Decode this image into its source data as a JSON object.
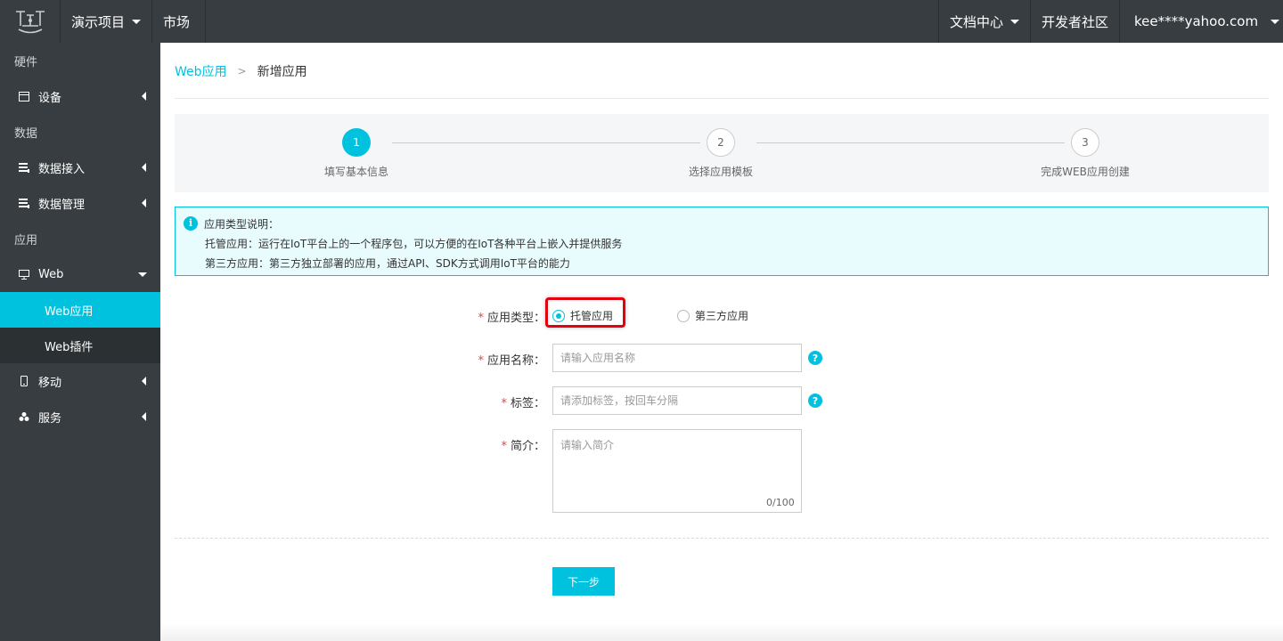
{
  "topbar": {
    "logo_icon": "iot-logo-icon",
    "project_label": "演示项目",
    "market_label": "市场",
    "docs_label": "文档中心",
    "community_label": "开发者社区",
    "user_label": "kee****yahoo.com"
  },
  "sidebar": {
    "group_hardware": "硬件",
    "item_device": "设备",
    "group_data": "数据",
    "item_data_access": "数据接入",
    "item_data_manage": "数据管理",
    "group_app": "应用",
    "item_web": "Web",
    "sub_web_app": "Web应用",
    "sub_web_plugin": "Web插件",
    "item_mobile": "移动",
    "item_service": "服务"
  },
  "breadcrumb": {
    "parent": "Web应用",
    "separator": ">",
    "current": "新增应用"
  },
  "steps": [
    {
      "number": "1",
      "label": "填写基本信息",
      "state": "active"
    },
    {
      "number": "2",
      "label": "选择应用模板",
      "state": "pending"
    },
    {
      "number": "3",
      "label": "完成WEB应用创建",
      "state": "pending"
    }
  ],
  "notice": {
    "icon": "info-icon",
    "title": "应用类型说明：",
    "line1": "托管应用：运行在IoT平台上的一个程序包，可以方便的在IoT各种平台上嵌入并提供服务",
    "line2": "第三方应用：第三方独立部署的应用，通过API、SDK方式调用IoT平台的能力"
  },
  "form": {
    "required_mark": "*",
    "type_label": "应用类型：",
    "type_options": [
      "托管应用",
      "第三方应用"
    ],
    "type_selected": "托管应用",
    "name_label": "应用名称：",
    "name_placeholder": "请输入应用名称",
    "tags_label": "标签：",
    "tags_placeholder": "请添加标签，按回车分隔",
    "intro_label": "简介：",
    "intro_placeholder": "请输入简介",
    "intro_counter": "0/100",
    "help_glyph": "?",
    "next_button": "下一步"
  },
  "colors": {
    "accent": "#00c1de",
    "sidebar_bg": "#373d41",
    "highlight_border": "#e4000f",
    "required": "#f04134"
  }
}
